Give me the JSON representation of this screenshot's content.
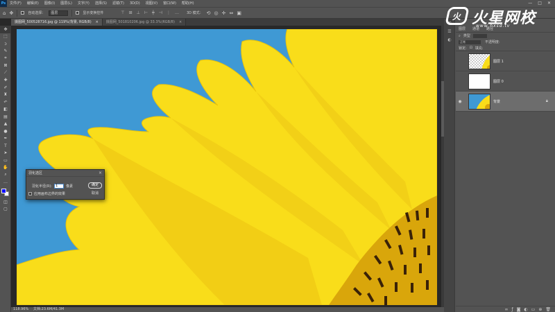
{
  "app": {
    "logo": "Ps"
  },
  "menubar": {
    "items": [
      "文件(F)",
      "编辑(E)",
      "图像(I)",
      "图层(L)",
      "文字(Y)",
      "选择(S)",
      "滤镜(T)",
      "3D(D)",
      "视图(V)",
      "窗口(W)",
      "帮助(H)"
    ],
    "window_controls": [
      "—",
      "□",
      "✕"
    ]
  },
  "options": {
    "auto_select_label": "自动选择：",
    "auto_select_value": "图层",
    "show_transform_label": "显示变换控件",
    "mode_3d_label": "3D 模式："
  },
  "tabs": [
    {
      "label": "摄图网_500528716.jpg @ 119%(背景, RGB/8)",
      "close": "×",
      "active": true
    },
    {
      "label": "摄图网_501810206.jpg @ 33.3%(RGB/8)",
      "close": "×",
      "active": false
    }
  ],
  "status": {
    "zoom": "118.96%",
    "doc": "文档:23.6M/41.3M"
  },
  "dialog": {
    "title": "羽化选区",
    "close": "×",
    "radius_label": "羽化半径(R):",
    "radius_value": "1",
    "radius_unit": "像素",
    "checkbox_label": "应用画布边界的效果",
    "ok_label": "确定",
    "cancel_label": "取消"
  },
  "layers_panel": {
    "tabs": [
      "图层",
      "通道",
      "路径"
    ],
    "filter_label": "类型",
    "blend_mode": "正常",
    "opacity_label": "不透明度:",
    "lock_label": "锁定:",
    "fill_label": "填充:",
    "layers": [
      {
        "name": "图层 1",
        "thumb": "checker",
        "selected": false,
        "visible": false,
        "locked": false
      },
      {
        "name": "图层 0",
        "thumb": "white",
        "selected": false,
        "visible": false,
        "locked": false
      },
      {
        "name": "背景",
        "thumb": "photo",
        "selected": true,
        "visible": true,
        "locked": true
      }
    ]
  },
  "watermark": {
    "title": "火星网校",
    "url": "www.hxsd.tv",
    "logo_glyph": "火"
  },
  "colors": {
    "sky": "#3f99d4",
    "petal": "#f9dd1a",
    "foreground": "#0a0aff",
    "background": "#ffffff"
  }
}
